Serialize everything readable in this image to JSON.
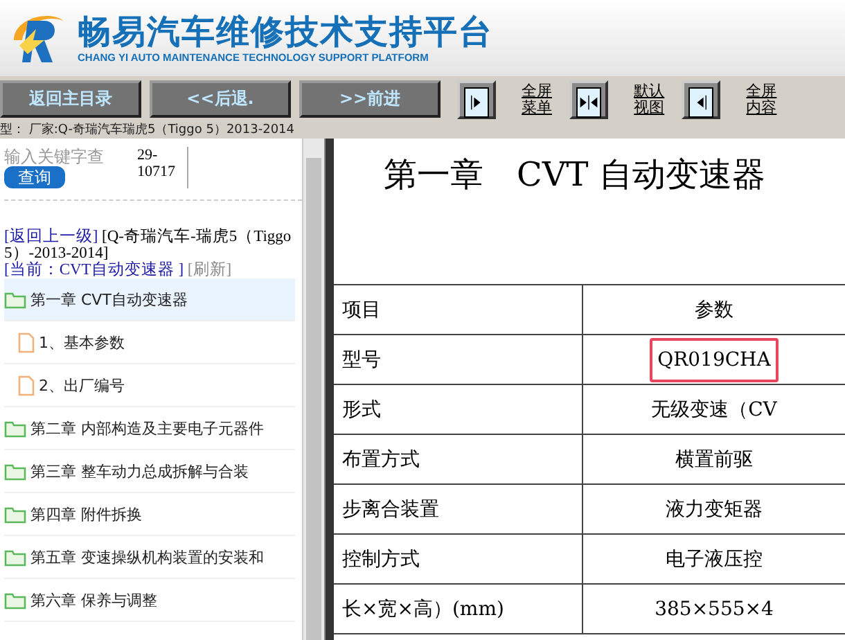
{
  "header": {
    "title": "畅易汽车维修技术支持平台",
    "subtitle": "CHANG YI AUTO MAINTENANCE TECHNOLOGY SUPPORT PLATFORM"
  },
  "nav_buttons": [
    "返回主目录",
    "<<后退.",
    ">>前进"
  ],
  "view_buttons": [
    {
      "kind": "menu",
      "label": "全屏菜单"
    },
    {
      "kind": "default",
      "label": "默认视图"
    },
    {
      "kind": "content",
      "label": "全屏内容"
    }
  ],
  "path": "型： 厂家:Q-奇瑞汽车瑞虎5（Tiggo 5）2013-2014",
  "sidebar": {
    "search": {
      "placeholder": "输入关键字查",
      "note": "29-10717",
      "button": "查询"
    },
    "back_link": "[返回上一级]",
    "model": "[Q-奇瑞汽车-瑞虎5（Tiggo 5）-2013-2014]",
    "current": "[当前：CVT自动变速器 ]",
    "refresh": "[刷新]",
    "items": [
      {
        "kind": "folder",
        "label": "第一章 CVT自动变速器",
        "selected": true,
        "children": [
          {
            "kind": "file",
            "label": "1、基本参数",
            "selected": false
          },
          {
            "kind": "file",
            "label": "2、出厂编号",
            "selected": false
          }
        ]
      },
      {
        "kind": "folder",
        "label": "第二章 内部构造及主要电子元器件",
        "selected": false
      },
      {
        "kind": "folder",
        "label": "第三章 整车动力总成拆解与合装",
        "selected": false
      },
      {
        "kind": "folder",
        "label": "第四章 附件拆换",
        "selected": false
      },
      {
        "kind": "folder",
        "label": "第五章 变速操纵机构装置的安装和",
        "selected": false
      },
      {
        "kind": "folder",
        "label": "第六章 保养与调整",
        "selected": false
      }
    ]
  },
  "document": {
    "title": "第一章　CVT 自动变速器",
    "table": {
      "columns": [
        "项目",
        "参数"
      ],
      "rows": [
        {
          "item": "型号",
          "value": "QR019CHA",
          "highlighted": true
        },
        {
          "item": "形式",
          "value": "无级变速（CV",
          "highlighted": false
        },
        {
          "item": "布置方式",
          "value": "横置前驱",
          "highlighted": false
        },
        {
          "item": "步离合装置",
          "value": "液力变矩器",
          "highlighted": false
        },
        {
          "item": "控制方式",
          "value": "电子液压控",
          "highlighted": false
        },
        {
          "item": "长×宽×高）(mm)",
          "value": "385×555×4",
          "highlighted": false
        }
      ]
    }
  }
}
